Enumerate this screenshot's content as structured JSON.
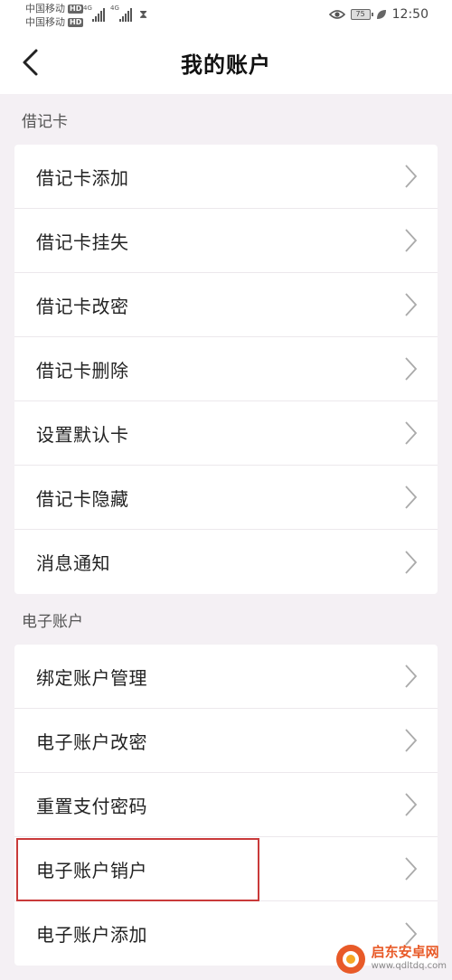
{
  "status_bar": {
    "carrier1": "中国移动",
    "carrier2": "中国移动",
    "hd_badge": "HD",
    "network1": "4G",
    "network2": "4G",
    "battery_level": "75",
    "time": "12:50"
  },
  "header": {
    "title": "我的账户"
  },
  "sections": [
    {
      "label": "借记卡",
      "items": [
        "借记卡添加",
        "借记卡挂失",
        "借记卡改密",
        "借记卡删除",
        "设置默认卡",
        "借记卡隐藏",
        "消息通知"
      ]
    },
    {
      "label": "电子账户",
      "items": [
        "绑定账户管理",
        "电子账户改密",
        "重置支付密码",
        "电子账户销户",
        "电子账户添加"
      ]
    }
  ],
  "highlighted_item": "电子账户销户",
  "watermark": {
    "name": "启东安卓网",
    "url": "www.qdltdq.com"
  },
  "colors": {
    "background": "#f4f0f4",
    "highlight": "#c93a3a",
    "watermark": "#e85a28"
  }
}
